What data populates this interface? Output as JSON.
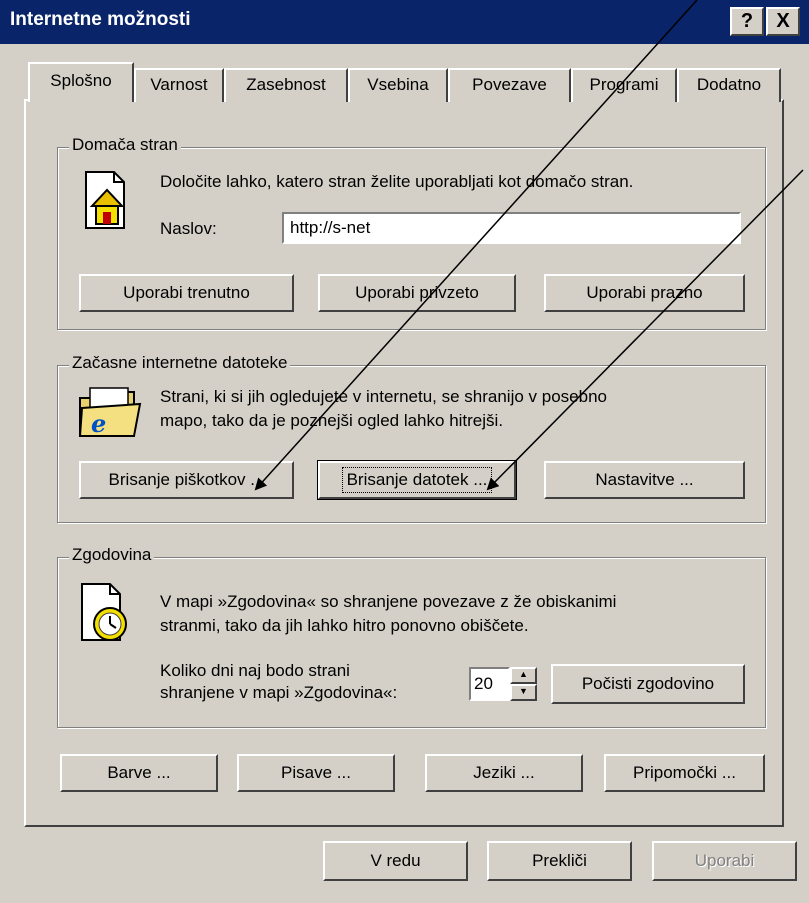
{
  "window": {
    "title": "Internetne možnosti",
    "help_label": "?",
    "close_label": "X"
  },
  "tabs": [
    "Splošno",
    "Varnost",
    "Zasebnost",
    "Vsebina",
    "Povezave",
    "Programi",
    "Dodatno"
  ],
  "home_page": {
    "group_label": "Domača stran",
    "description": "Določite lahko, katero stran želite uporabljati kot domačo stran.",
    "address_label": "Naslov:",
    "address_value": "http://s-net",
    "use_current": "Uporabi trenutno",
    "use_default": "Uporabi privzeto",
    "use_blank": "Uporabi prazno"
  },
  "temp_files": {
    "group_label": "Začasne internetne datoteke",
    "description_line1": "Strani, ki si jih ogledujete v internetu, se shranijo v posebno",
    "description_line2": "mapo, tako da je poznejši ogled lahko hitrejši.",
    "delete_cookies": "Brisanje piškotkov ...",
    "delete_files": "Brisanje datotek ...",
    "settings": "Nastavitve ..."
  },
  "history": {
    "group_label": "Zgodovina",
    "description_line1": "V mapi »Zgodovina« so shranjene povezave z že obiskanimi",
    "description_line2": "stranmi, tako da jih lahko hitro ponovno obiščete.",
    "days_label_line1": "Koliko dni naj bodo strani",
    "days_label_line2": "shranjene v mapi »Zgodovina«:",
    "days_value": "20",
    "clear_history": "Počisti zgodovino"
  },
  "bottom_buttons": {
    "colors": "Barve ...",
    "fonts": "Pisave ...",
    "languages": "Jeziki ...",
    "accessibility": "Pripomočki ..."
  },
  "dialog_buttons": {
    "ok": "V redu",
    "cancel": "Prekliči",
    "apply": "Uporabi"
  },
  "colors": {
    "titlebar": "#0a246a",
    "face": "#d4d0c8",
    "shadow": "#808080"
  }
}
